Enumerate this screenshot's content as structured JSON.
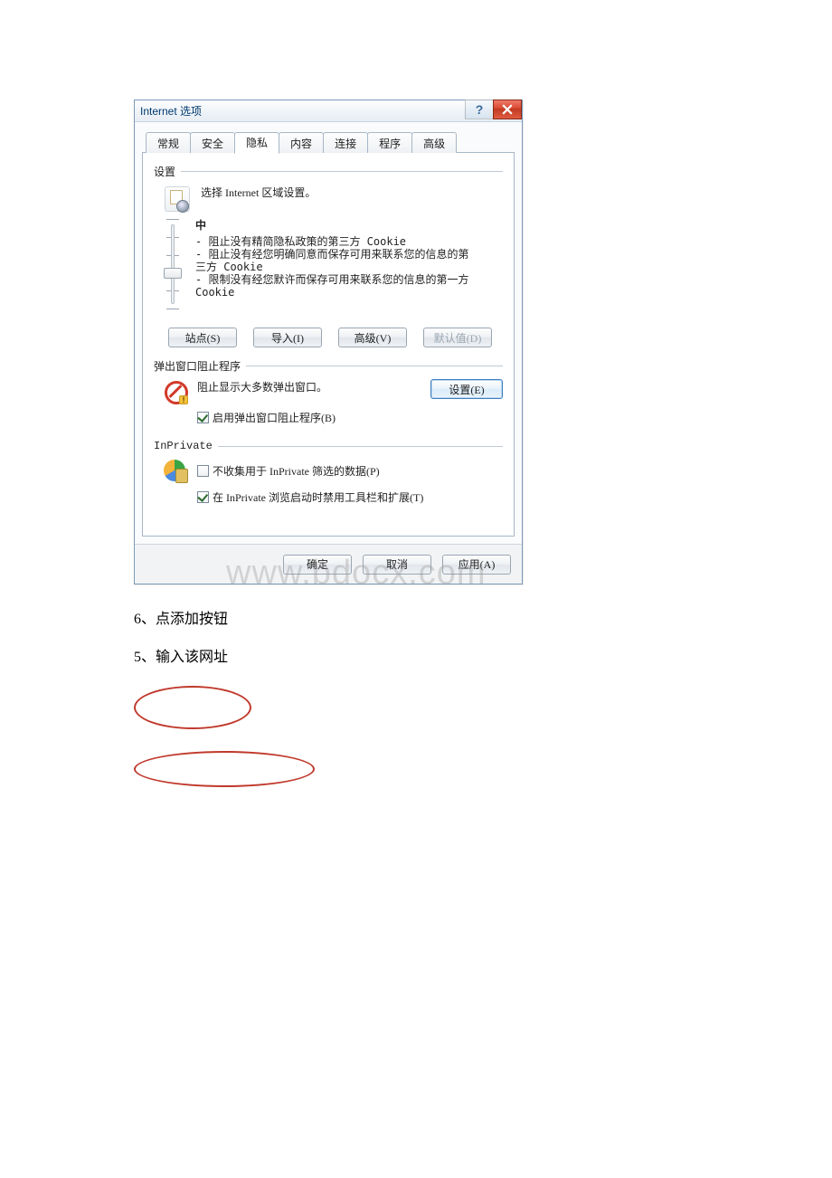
{
  "dialog": {
    "title": "Internet 选项",
    "tabs": [
      "常规",
      "安全",
      "隐私",
      "内容",
      "连接",
      "程序",
      "高级"
    ],
    "activeTab": 2,
    "settings": {
      "groupLabel": "设置",
      "zoneText": "选择 Internet 区域设置。",
      "sliderHead": "中",
      "sliderLines": [
        "- 阻止没有精简隐私政策的第三方 Cookie",
        "- 阻止没有经您明确同意而保存可用来联系您的信息的第三方 Cookie",
        "- 限制没有经您默许而保存可用来联系您的信息的第一方 Cookie"
      ],
      "btnSites": "站点(S)",
      "btnImport": "导入(I)",
      "btnAdvanced": "高级(V)",
      "btnDefault": "默认值(D)"
    },
    "popup": {
      "groupLabel": "弹出窗口阻止程序",
      "line": "阻止显示大多数弹出窗口。",
      "btnSettings": "设置(E)",
      "checkboxLabel": "启用弹出窗口阻止程序(B)",
      "checked": true
    },
    "inprivate": {
      "groupLabel": "InPrivate",
      "chk1Label": "不收集用于 InPrivate 筛选的数据(P)",
      "chk1": false,
      "chk2Label": "在 InPrivate 浏览启动时禁用工具栏和扩展(T)",
      "chk2": true
    },
    "footer": {
      "ok": "确定",
      "cancel": "取消",
      "apply": "应用(A)"
    }
  },
  "watermark": "www.bdocx.com",
  "docLines": {
    "l1": "6、点添加按钮",
    "l2": "5、输入该网址"
  }
}
